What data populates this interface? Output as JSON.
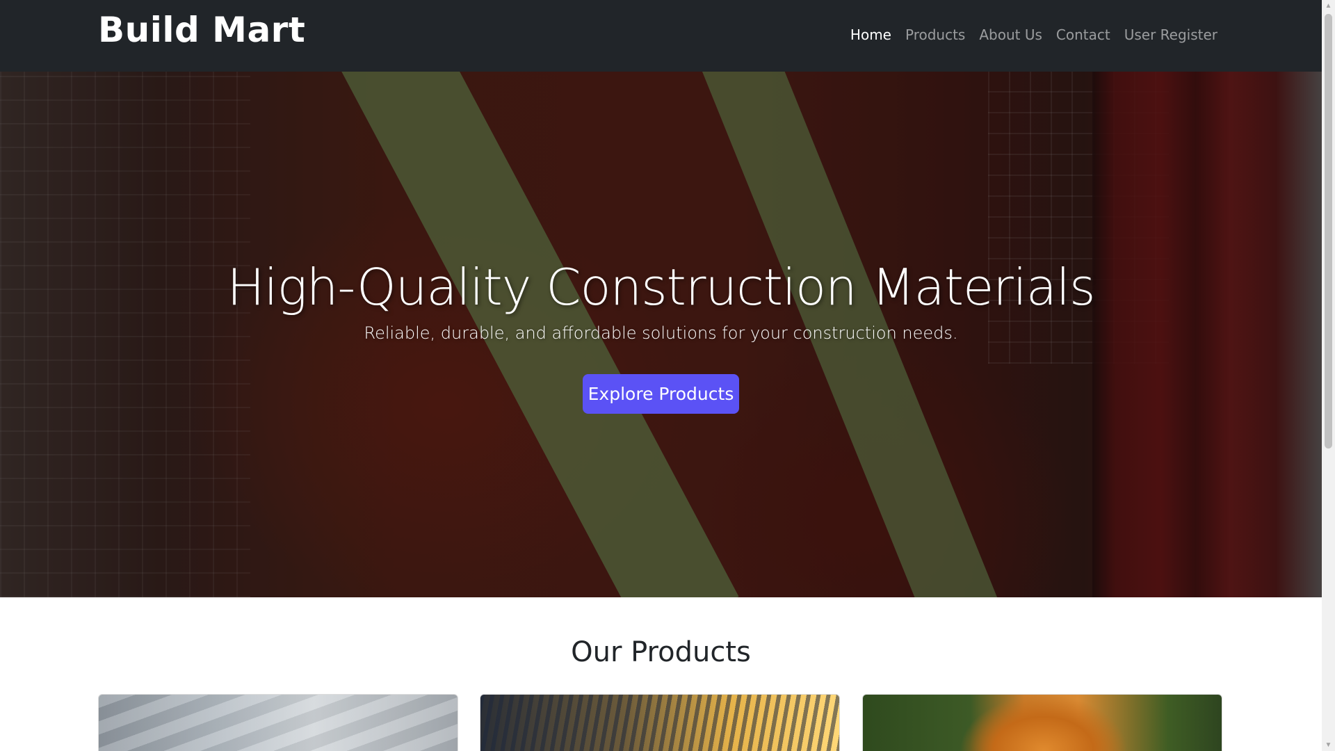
{
  "navbar": {
    "brand": "Build Mart",
    "links": [
      {
        "label": "Home",
        "active": true
      },
      {
        "label": "Products",
        "active": false
      },
      {
        "label": "About Us",
        "active": false
      },
      {
        "label": "Contact",
        "active": false
      },
      {
        "label": "User Register",
        "active": false
      }
    ]
  },
  "hero": {
    "title": "High-Quality Construction Materials",
    "subtitle": "Reliable, durable, and affordable solutions for your construction needs.",
    "cta_label": "Explore Products",
    "cta_color": "#5b52f5"
  },
  "products": {
    "heading": "Our Products"
  },
  "scrollbar": {
    "up_icon": "▲",
    "down_icon": "▼"
  },
  "colors": {
    "navbar_bg": "#212529",
    "accent": "#5b52f5"
  }
}
